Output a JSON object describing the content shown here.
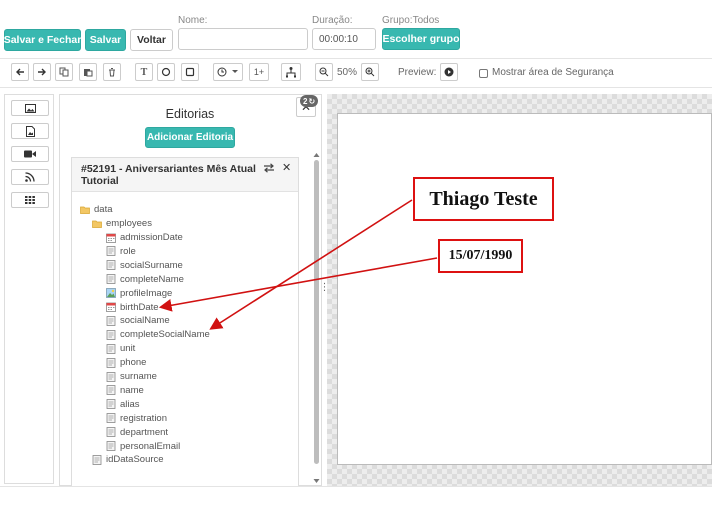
{
  "header": {
    "save_close": "Salvar e Fechar",
    "save": "Salvar",
    "back": "Voltar",
    "name_label": "Nome:",
    "name_value": "",
    "duration_label": "Duração:",
    "duration_value": "00:00:10",
    "group_label": "Grupo:Todos",
    "choose_group": "Escolher grupo"
  },
  "toolbar": {
    "text_tool": "T",
    "counter": "1+",
    "zoom": "50%",
    "preview_label": "Preview:",
    "safety_label": "Mostrar área de Segurança"
  },
  "panel": {
    "title": "Editorias",
    "badge": "2",
    "add_button": "Adicionar Editoria",
    "card_title": "#52191 - Aniversariantes Mês Atual Tutorial",
    "tree": {
      "root": "data",
      "folder": "employees",
      "fields": [
        "admissionDate",
        "role",
        "socialSurname",
        "completeName",
        "profileImage",
        "birthDate",
        "socialName",
        "completeSocialName",
        "unit",
        "phone",
        "surname",
        "name",
        "alias",
        "registration",
        "department",
        "personalEmail"
      ],
      "footer": "idDataSource"
    }
  },
  "canvas": {
    "name_text": "Thiago Teste",
    "date_text": "15/07/1990"
  },
  "colors": {
    "accent": "#38b8b0",
    "annotation": "#d11111"
  },
  "icons": {
    "calendar_fields": [
      "admissionDate",
      "birthDate"
    ],
    "image_fields": [
      "profileImage"
    ]
  }
}
